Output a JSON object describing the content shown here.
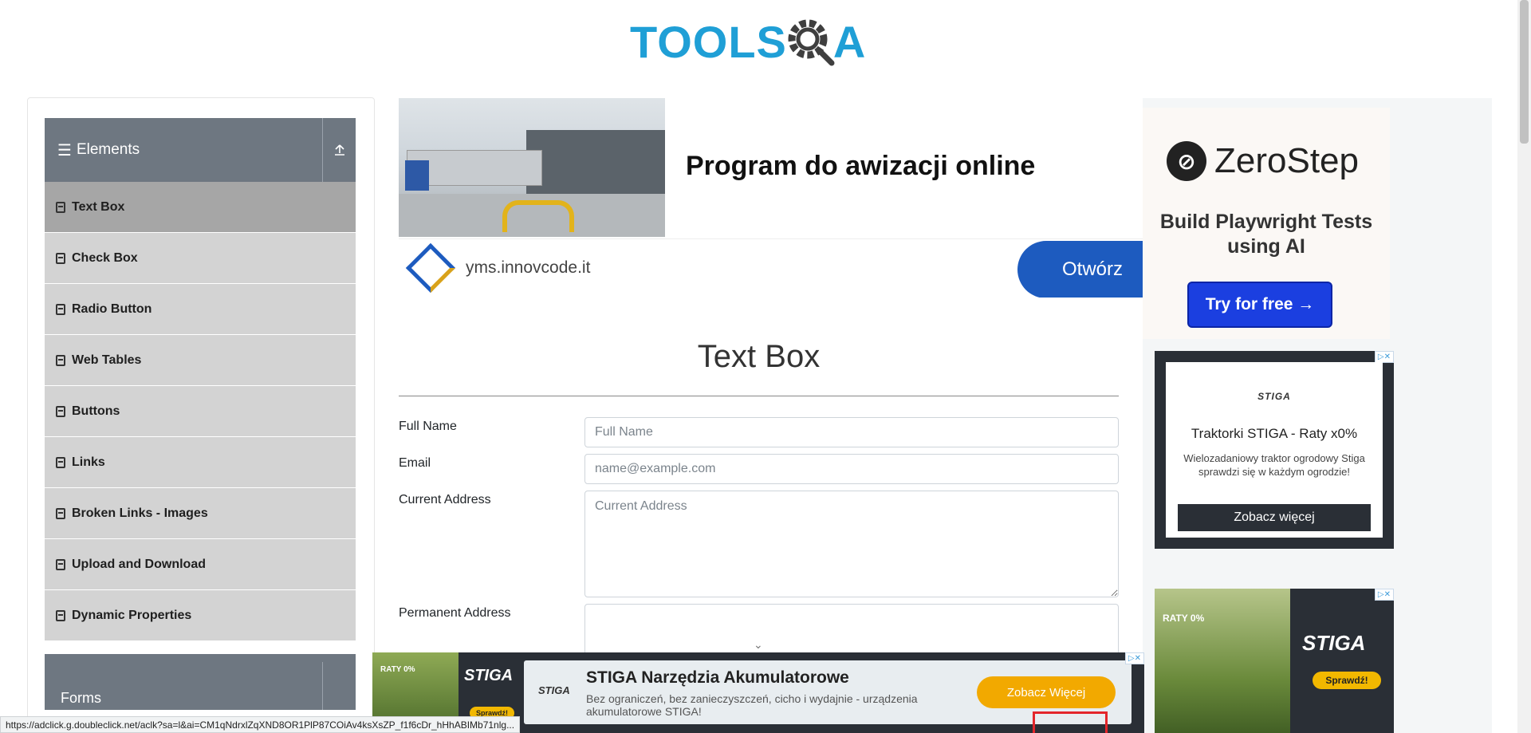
{
  "header": {
    "logo_text_main": "TOOLS",
    "logo_text_tail": "A"
  },
  "sidebar": {
    "group_title": "Elements",
    "items": [
      {
        "label": "Text Box",
        "active": true
      },
      {
        "label": "Check Box"
      },
      {
        "label": "Radio Button"
      },
      {
        "label": "Web Tables"
      },
      {
        "label": "Buttons"
      },
      {
        "label": "Links"
      },
      {
        "label": "Broken Links - Images"
      },
      {
        "label": "Upload and Download"
      },
      {
        "label": "Dynamic Properties"
      }
    ],
    "next_group_title": "Forms"
  },
  "ad_top": {
    "headline": "Program do awizacji online",
    "domain": "yms.innovcode.it",
    "button": "Otwórz"
  },
  "form": {
    "title": "Text Box",
    "full_name_label": "Full Name",
    "full_name_placeholder": "Full Name",
    "email_label": "Email",
    "email_placeholder": "name@example.com",
    "current_address_label": "Current Address",
    "current_address_placeholder": "Current Address",
    "permanent_address_label": "Permanent Address"
  },
  "ad_zerostep": {
    "brand": "ZeroStep",
    "tagline": "Build Playwright Tests using AI",
    "button": "Try for free →"
  },
  "ad_stiga_card": {
    "brand": "STIGA",
    "title": "Traktorki STIGA - Raty x0%",
    "description": "Wielozadaniowy traktor ogrodowy Stiga sprawdzi się w każdym ogrodzie!",
    "button": "Zobacz więcej"
  },
  "ad_stiga_image": {
    "badge": "RATY 0%",
    "brand": "STIGA",
    "button": "Sprawdź!"
  },
  "ad_bottom": {
    "badge": "RATY 0%",
    "brand": "STIGA",
    "small_button": "Sprawdź!",
    "title": "STIGA Narzędzia Akumulatorowe",
    "description": "Bez ograniczeń, bez zanieczyszczeń, cicho i wydajnie - urządzenia akumulatorowe STIGA!",
    "cta": "Zobacz Więcej"
  },
  "status_bar": {
    "url": "https://adclick.g.doubleclick.net/aclk?sa=l&ai=CM1qNdrxlZqXND8OR1PlP87COiAv4ksXsZP_f1f6cDr_hHhABIMb71nlg..."
  },
  "colors": {
    "accent": "#1f9fd6",
    "sidebar_header": "#6e7781",
    "sidebar_item": "#d3d3d3",
    "sidebar_active": "#a6a6a6"
  }
}
